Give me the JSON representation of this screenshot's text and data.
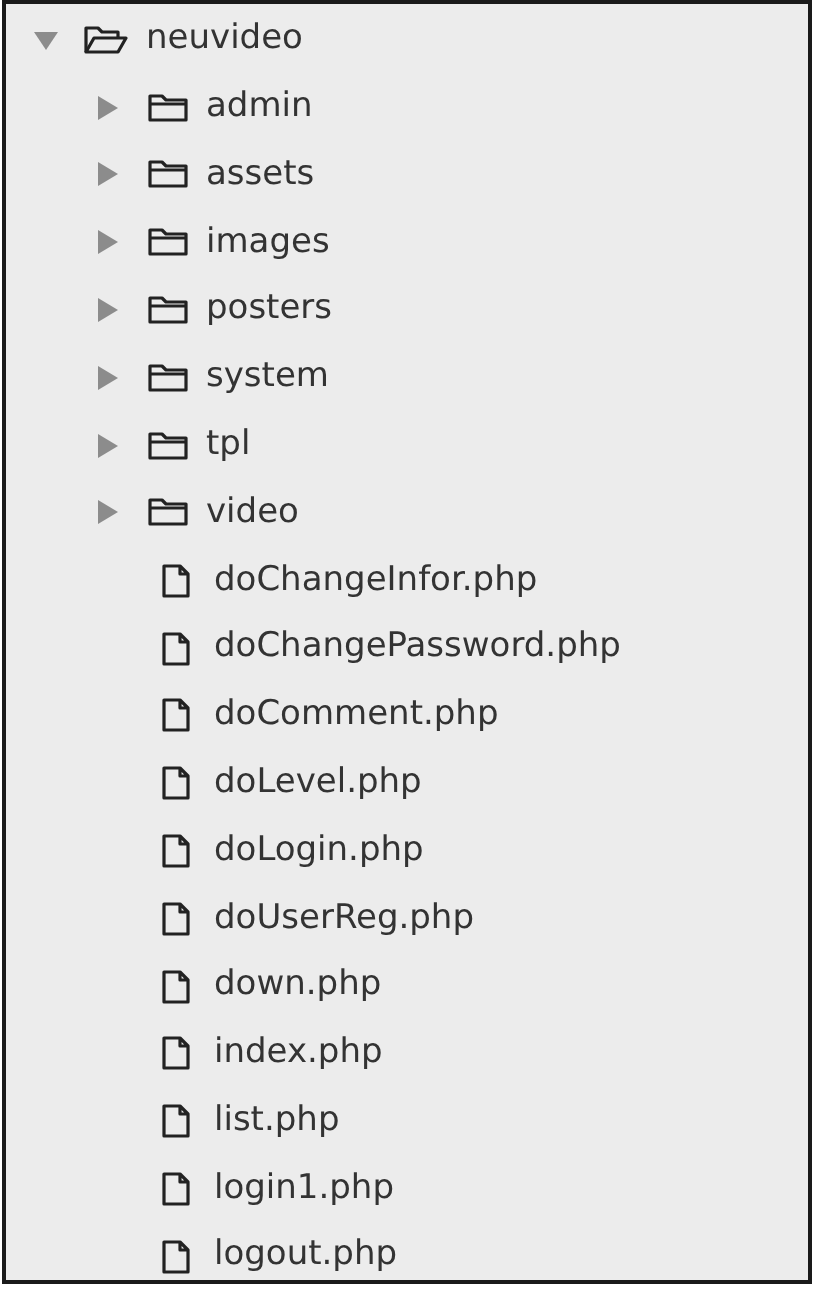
{
  "tree": [
    {
      "kind": "folder",
      "name": "neuvideo",
      "expanded": true,
      "children": [
        {
          "kind": "folder",
          "name": "admin",
          "expanded": false
        },
        {
          "kind": "folder",
          "name": "assets",
          "expanded": false
        },
        {
          "kind": "folder",
          "name": "images",
          "expanded": false
        },
        {
          "kind": "folder",
          "name": "posters",
          "expanded": false
        },
        {
          "kind": "folder",
          "name": "system",
          "expanded": false
        },
        {
          "kind": "folder",
          "name": "tpl",
          "expanded": false
        },
        {
          "kind": "folder",
          "name": "video",
          "expanded": false
        },
        {
          "kind": "file",
          "name": "doChangeInfor.php"
        },
        {
          "kind": "file",
          "name": "doChangePassword.php"
        },
        {
          "kind": "file",
          "name": "doComment.php"
        },
        {
          "kind": "file",
          "name": "doLevel.php"
        },
        {
          "kind": "file",
          "name": "doLogin.php"
        },
        {
          "kind": "file",
          "name": "doUserReg.php"
        },
        {
          "kind": "file",
          "name": "down.php"
        },
        {
          "kind": "file",
          "name": "index.php"
        },
        {
          "kind": "file",
          "name": "list.php"
        },
        {
          "kind": "file",
          "name": "login1.php"
        },
        {
          "kind": "file",
          "name": "logout.php"
        }
      ]
    }
  ]
}
